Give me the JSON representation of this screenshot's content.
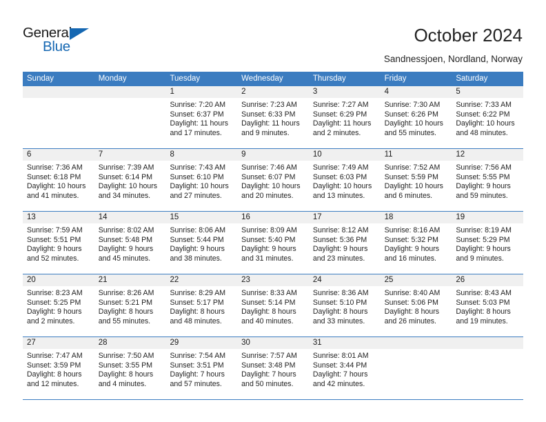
{
  "brand": {
    "name_top": "General",
    "name_bottom": "Blue",
    "accent_color": "#1567b2"
  },
  "header": {
    "title": "October 2024",
    "subtitle": "Sandnessjoen, Nordland, Norway"
  },
  "calendar": {
    "header_color": "#3b7cc0",
    "number_row_color": "#f0f0f0",
    "weekdays": [
      "Sunday",
      "Monday",
      "Tuesday",
      "Wednesday",
      "Thursday",
      "Friday",
      "Saturday"
    ],
    "weeks": [
      [
        {
          "day": "",
          "lines": []
        },
        {
          "day": "",
          "lines": []
        },
        {
          "day": "1",
          "lines": [
            "Sunrise: 7:20 AM",
            "Sunset: 6:37 PM",
            "Daylight: 11 hours",
            "and 17 minutes."
          ]
        },
        {
          "day": "2",
          "lines": [
            "Sunrise: 7:23 AM",
            "Sunset: 6:33 PM",
            "Daylight: 11 hours",
            "and 9 minutes."
          ]
        },
        {
          "day": "3",
          "lines": [
            "Sunrise: 7:27 AM",
            "Sunset: 6:29 PM",
            "Daylight: 11 hours",
            "and 2 minutes."
          ]
        },
        {
          "day": "4",
          "lines": [
            "Sunrise: 7:30 AM",
            "Sunset: 6:26 PM",
            "Daylight: 10 hours",
            "and 55 minutes."
          ]
        },
        {
          "day": "5",
          "lines": [
            "Sunrise: 7:33 AM",
            "Sunset: 6:22 PM",
            "Daylight: 10 hours",
            "and 48 minutes."
          ]
        }
      ],
      [
        {
          "day": "6",
          "lines": [
            "Sunrise: 7:36 AM",
            "Sunset: 6:18 PM",
            "Daylight: 10 hours",
            "and 41 minutes."
          ]
        },
        {
          "day": "7",
          "lines": [
            "Sunrise: 7:39 AM",
            "Sunset: 6:14 PM",
            "Daylight: 10 hours",
            "and 34 minutes."
          ]
        },
        {
          "day": "8",
          "lines": [
            "Sunrise: 7:43 AM",
            "Sunset: 6:10 PM",
            "Daylight: 10 hours",
            "and 27 minutes."
          ]
        },
        {
          "day": "9",
          "lines": [
            "Sunrise: 7:46 AM",
            "Sunset: 6:07 PM",
            "Daylight: 10 hours",
            "and 20 minutes."
          ]
        },
        {
          "day": "10",
          "lines": [
            "Sunrise: 7:49 AM",
            "Sunset: 6:03 PM",
            "Daylight: 10 hours",
            "and 13 minutes."
          ]
        },
        {
          "day": "11",
          "lines": [
            "Sunrise: 7:52 AM",
            "Sunset: 5:59 PM",
            "Daylight: 10 hours",
            "and 6 minutes."
          ]
        },
        {
          "day": "12",
          "lines": [
            "Sunrise: 7:56 AM",
            "Sunset: 5:55 PM",
            "Daylight: 9 hours",
            "and 59 minutes."
          ]
        }
      ],
      [
        {
          "day": "13",
          "lines": [
            "Sunrise: 7:59 AM",
            "Sunset: 5:51 PM",
            "Daylight: 9 hours",
            "and 52 minutes."
          ]
        },
        {
          "day": "14",
          "lines": [
            "Sunrise: 8:02 AM",
            "Sunset: 5:48 PM",
            "Daylight: 9 hours",
            "and 45 minutes."
          ]
        },
        {
          "day": "15",
          "lines": [
            "Sunrise: 8:06 AM",
            "Sunset: 5:44 PM",
            "Daylight: 9 hours",
            "and 38 minutes."
          ]
        },
        {
          "day": "16",
          "lines": [
            "Sunrise: 8:09 AM",
            "Sunset: 5:40 PM",
            "Daylight: 9 hours",
            "and 31 minutes."
          ]
        },
        {
          "day": "17",
          "lines": [
            "Sunrise: 8:12 AM",
            "Sunset: 5:36 PM",
            "Daylight: 9 hours",
            "and 23 minutes."
          ]
        },
        {
          "day": "18",
          "lines": [
            "Sunrise: 8:16 AM",
            "Sunset: 5:32 PM",
            "Daylight: 9 hours",
            "and 16 minutes."
          ]
        },
        {
          "day": "19",
          "lines": [
            "Sunrise: 8:19 AM",
            "Sunset: 5:29 PM",
            "Daylight: 9 hours",
            "and 9 minutes."
          ]
        }
      ],
      [
        {
          "day": "20",
          "lines": [
            "Sunrise: 8:23 AM",
            "Sunset: 5:25 PM",
            "Daylight: 9 hours",
            "and 2 minutes."
          ]
        },
        {
          "day": "21",
          "lines": [
            "Sunrise: 8:26 AM",
            "Sunset: 5:21 PM",
            "Daylight: 8 hours",
            "and 55 minutes."
          ]
        },
        {
          "day": "22",
          "lines": [
            "Sunrise: 8:29 AM",
            "Sunset: 5:17 PM",
            "Daylight: 8 hours",
            "and 48 minutes."
          ]
        },
        {
          "day": "23",
          "lines": [
            "Sunrise: 8:33 AM",
            "Sunset: 5:14 PM",
            "Daylight: 8 hours",
            "and 40 minutes."
          ]
        },
        {
          "day": "24",
          "lines": [
            "Sunrise: 8:36 AM",
            "Sunset: 5:10 PM",
            "Daylight: 8 hours",
            "and 33 minutes."
          ]
        },
        {
          "day": "25",
          "lines": [
            "Sunrise: 8:40 AM",
            "Sunset: 5:06 PM",
            "Daylight: 8 hours",
            "and 26 minutes."
          ]
        },
        {
          "day": "26",
          "lines": [
            "Sunrise: 8:43 AM",
            "Sunset: 5:03 PM",
            "Daylight: 8 hours",
            "and 19 minutes."
          ]
        }
      ],
      [
        {
          "day": "27",
          "lines": [
            "Sunrise: 7:47 AM",
            "Sunset: 3:59 PM",
            "Daylight: 8 hours",
            "and 12 minutes."
          ]
        },
        {
          "day": "28",
          "lines": [
            "Sunrise: 7:50 AM",
            "Sunset: 3:55 PM",
            "Daylight: 8 hours",
            "and 4 minutes."
          ]
        },
        {
          "day": "29",
          "lines": [
            "Sunrise: 7:54 AM",
            "Sunset: 3:51 PM",
            "Daylight: 7 hours",
            "and 57 minutes."
          ]
        },
        {
          "day": "30",
          "lines": [
            "Sunrise: 7:57 AM",
            "Sunset: 3:48 PM",
            "Daylight: 7 hours",
            "and 50 minutes."
          ]
        },
        {
          "day": "31",
          "lines": [
            "Sunrise: 8:01 AM",
            "Sunset: 3:44 PM",
            "Daylight: 7 hours",
            "and 42 minutes."
          ]
        },
        {
          "day": "",
          "lines": []
        },
        {
          "day": "",
          "lines": []
        }
      ]
    ]
  }
}
